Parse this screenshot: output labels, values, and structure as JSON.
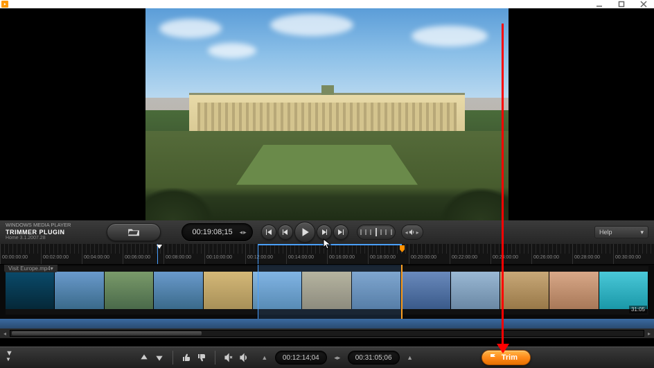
{
  "titlebar": {
    "icon": "media-player-icon"
  },
  "header": {
    "host_app": "WINDOWS MEDIA PLAYER",
    "plugin_name": "TRIMMER PLUGIN",
    "version": "Home 3.1.2007.28",
    "timecode_current": "00:19:08;15",
    "help_label": "Help"
  },
  "ruler": {
    "ticks": [
      "00:00:00:00",
      "00:02:00:00",
      "00:04:00:00",
      "00:06:00:00",
      "00:08:00:00",
      "00:10:00:00",
      "00:12:00:00",
      "00:14:00:00",
      "00:16:00:00",
      "00:18:00:00",
      "00:20:00:00",
      "00:22:00:00",
      "00:24:00:00",
      "00:26:00:00",
      "00:28:00:00",
      "00:30:00:00"
    ]
  },
  "timeline": {
    "file_label": "Visit Europe.mp4▾",
    "duration_label": "31:05"
  },
  "footer": {
    "tc_in": "00:12:14;04",
    "tc_out": "00:31:05;06",
    "trim_label": "Trim"
  }
}
